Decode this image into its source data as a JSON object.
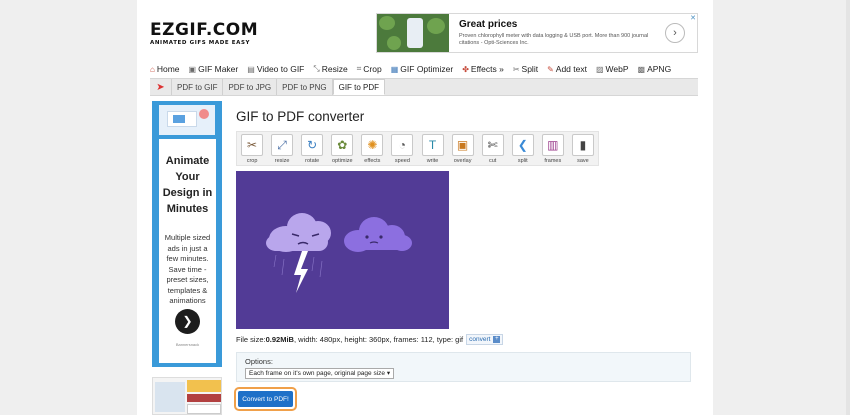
{
  "logo": {
    "main": "EZGIF.COM",
    "tagline": "ANIMATED GIFS MADE EASY"
  },
  "ad_top": {
    "title": "Great prices",
    "text": "Proven chlorophyll meter with data logging & USB port. More than 900 journal citations - Opti-Sciences Inc.",
    "arrow": "›",
    "close": "✕"
  },
  "nav": [
    {
      "label": "Home",
      "icon": "home-icon",
      "glyph": "⌂",
      "tone": "red"
    },
    {
      "label": "GIF Maker",
      "icon": "gif-maker-icon",
      "glyph": "▣",
      "tone": ""
    },
    {
      "label": "Video to GIF",
      "icon": "video-icon",
      "glyph": "▤",
      "tone": ""
    },
    {
      "label": "Resize",
      "icon": "resize-icon",
      "glyph": "⤡",
      "tone": ""
    },
    {
      "label": "Crop",
      "icon": "crop-icon",
      "glyph": "⌗",
      "tone": ""
    },
    {
      "label": "GIF Optimizer",
      "icon": "optimizer-icon",
      "glyph": "▦",
      "tone": "blue"
    },
    {
      "label": "Effects »",
      "icon": "effects-icon",
      "glyph": "✤",
      "tone": "red"
    },
    {
      "label": "Split",
      "icon": "split-icon",
      "glyph": "✂",
      "tone": ""
    },
    {
      "label": "Add text",
      "icon": "add-text-icon",
      "glyph": "✎",
      "tone": "red"
    },
    {
      "label": "WebP",
      "icon": "webp-icon",
      "glyph": "▨",
      "tone": ""
    },
    {
      "label": "APNG",
      "icon": "apng-icon",
      "glyph": "▩",
      "tone": ""
    }
  ],
  "subnav": {
    "pin_glyph": "➤",
    "tabs": [
      "PDF to GIF",
      "PDF to JPG",
      "PDF to PNG",
      "GIF to PDF"
    ],
    "active_index": 3
  },
  "side_ad": {
    "headline": "Animate Your Design in Minutes",
    "body": "Multiple sized ads in just a few minutes. Save time - preset sizes, templates & animations",
    "button": "❯",
    "brand": "Bannersnack"
  },
  "main": {
    "title": "GIF to PDF converter",
    "tools": [
      {
        "label": "crop",
        "icon": "crop-tool-icon",
        "glyph": "✂",
        "color": "#7a5a3a"
      },
      {
        "label": "resize",
        "icon": "resize-tool-icon",
        "glyph": "⤢",
        "color": "#4a6fa5"
      },
      {
        "label": "rotate",
        "icon": "rotate-tool-icon",
        "glyph": "↻",
        "color": "#3a7fc2"
      },
      {
        "label": "optimize",
        "icon": "optimize-tool-icon",
        "glyph": "✿",
        "color": "#6a8a3a"
      },
      {
        "label": "effects",
        "icon": "effects-tool-icon",
        "glyph": "✺",
        "color": "#e0901e"
      },
      {
        "label": "speed",
        "icon": "speed-tool-icon",
        "glyph": "◔",
        "color": "#555555"
      },
      {
        "label": "write",
        "icon": "write-tool-icon",
        "glyph": "T",
        "color": "#2a8aa8"
      },
      {
        "label": "overlay",
        "icon": "overlay-tool-icon",
        "glyph": "▣",
        "color": "#c8781e"
      },
      {
        "label": "cut",
        "icon": "cut-tool-icon",
        "glyph": "✄",
        "color": "#333333"
      },
      {
        "label": "split",
        "icon": "split-tool-icon",
        "glyph": "❮",
        "color": "#3a8ad6"
      },
      {
        "label": "frames",
        "icon": "frames-tool-icon",
        "glyph": "▥",
        "color": "#9a3a8a"
      },
      {
        "label": "save",
        "icon": "save-tool-icon",
        "glyph": "▮",
        "color": "#444444"
      }
    ],
    "fileinfo_prefix": "File size: ",
    "filesize": "0.92MiB",
    "fileinfo_rest": ", width: 480px, height: 360px, frames: 112, type: gif",
    "convert_link": "convert",
    "convert_link_plus": "+",
    "options_label": "Options:",
    "options_select": "Each frame on it's own page, original page size ▾",
    "convert_button": "Convert to PDF!"
  },
  "colors": {
    "preview_bg": "#523b96",
    "cloud_left": "#b9a6ec",
    "cloud_right": "#8c6fe0",
    "bolt": "#ffffff",
    "button": "#1e70c8",
    "button_ring": "#f0a04a"
  }
}
